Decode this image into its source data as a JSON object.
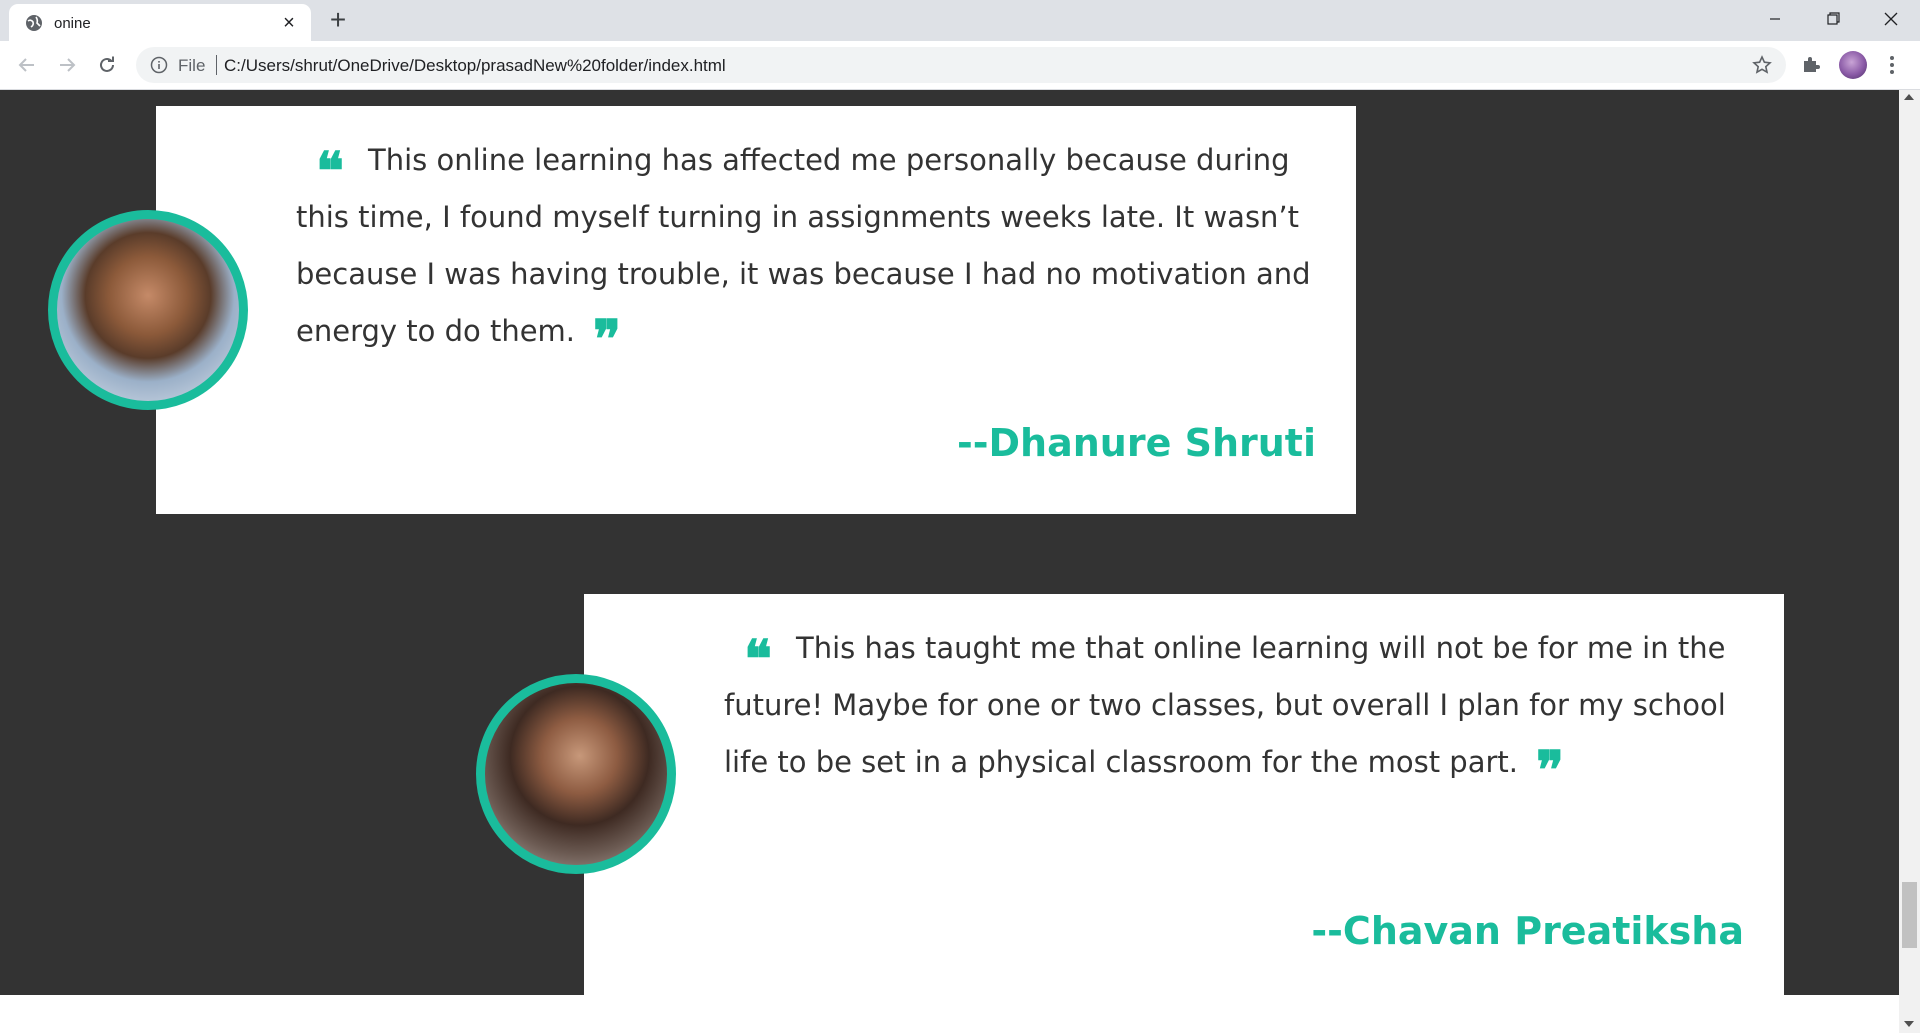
{
  "browser": {
    "tab_title": "onine",
    "tab_close": "×",
    "new_tab": "+",
    "file_label": "File",
    "url": "C:/Users/shrut/OneDrive/Desktop/prasadNew%20folder/index.html"
  },
  "colors": {
    "accent": "#1abc9c",
    "page_background": "#333333",
    "card_background": "#ffffff",
    "text": "#333333"
  },
  "testimonials": [
    {
      "quote": "This online learning has affected me personally because during this time, I found myself turning in assignments weeks late. It wasn’t because I was having trouble, it was because I had no motivation and energy to do them.",
      "author": "--Dhanure Shruti",
      "photo_icon": "student-photo"
    },
    {
      "quote": "This has taught me that online learning will not be for me in the future! Maybe for one or two classes, but overall I plan for my school life to be set in a physical classroom for the most part.",
      "author": "--Chavan Preatiksha",
      "photo_icon": "student-photo"
    }
  ],
  "quote_marks": {
    "open": "❝",
    "close": "❞"
  }
}
